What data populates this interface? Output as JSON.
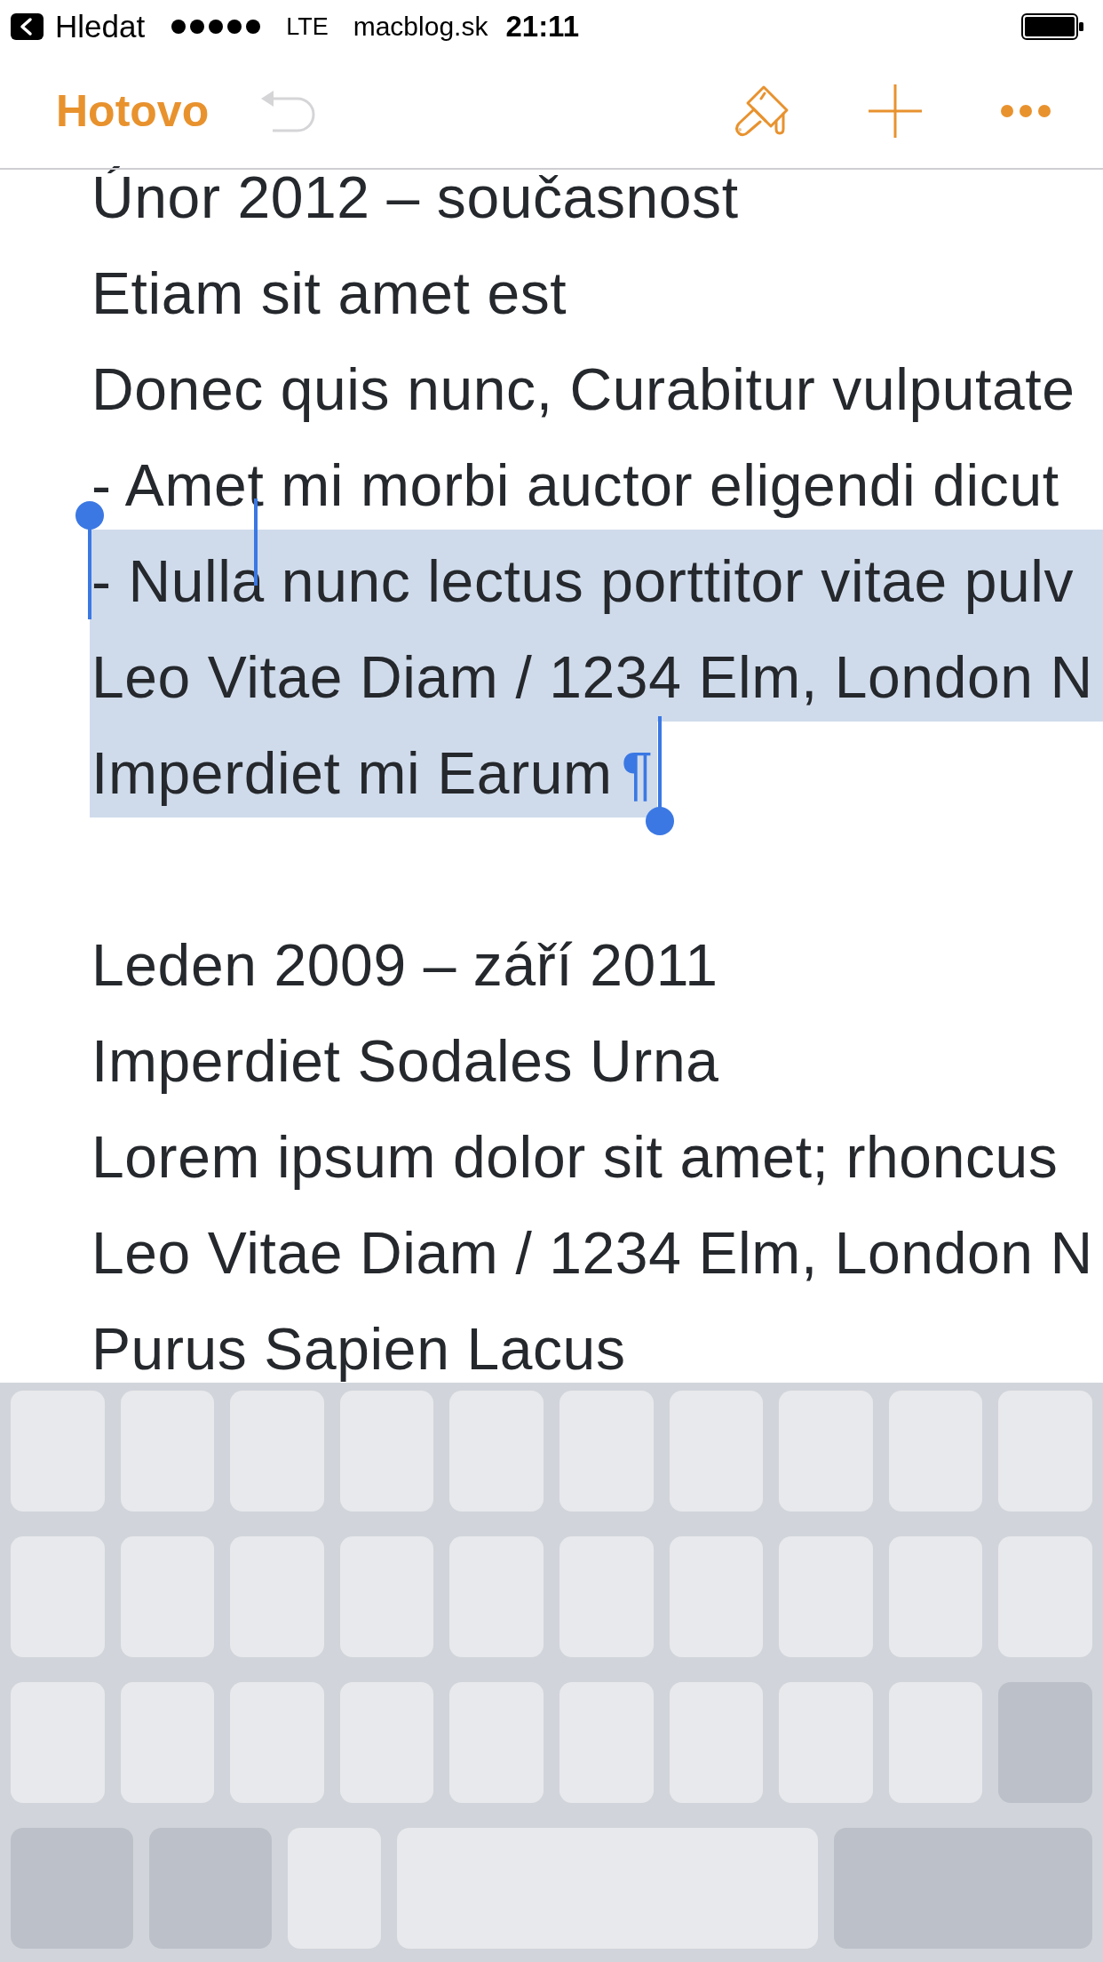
{
  "status_bar": {
    "back_label": "Hledat",
    "network": "LTE",
    "label": "macblog.sk",
    "time": "21:11"
  },
  "toolbar": {
    "done": "Hotovo",
    "undo": {
      "disabled": true
    }
  },
  "document": {
    "sections": [
      {
        "lines": [
          {
            "text": "Únor 2012 – současnost",
            "selected": false
          },
          {
            "text": "Etiam sit amet est",
            "selected": false
          },
          {
            "text": "Donec quis nunc, Curabitur vulputate",
            "selected": false
          },
          {
            "text": "- Amet mi morbi auctor eligendi dicut",
            "selected": false
          },
          {
            "text": "- Nulla nunc lectus porttitor vitae pulv",
            "selected": true
          },
          {
            "text": "Leo Vitae Diam / 1234 Elm, London N",
            "selected": true
          },
          {
            "text": "Imperdiet mi Earum",
            "selected": true,
            "end_mark": "¶"
          }
        ]
      },
      {
        "lines": [
          {
            "text": "Leden 2009 – září 2011",
            "selected": false
          },
          {
            "text": "Imperdiet Sodales Urna",
            "selected": false
          },
          {
            "text": "Lorem ipsum dolor sit amet; rhoncus",
            "selected": false
          },
          {
            "text": "Leo Vitae Diam / 1234 Elm, London N",
            "selected": false
          },
          {
            "text": "Purus Sapien Lacus",
            "selected": false
          }
        ]
      }
    ]
  }
}
